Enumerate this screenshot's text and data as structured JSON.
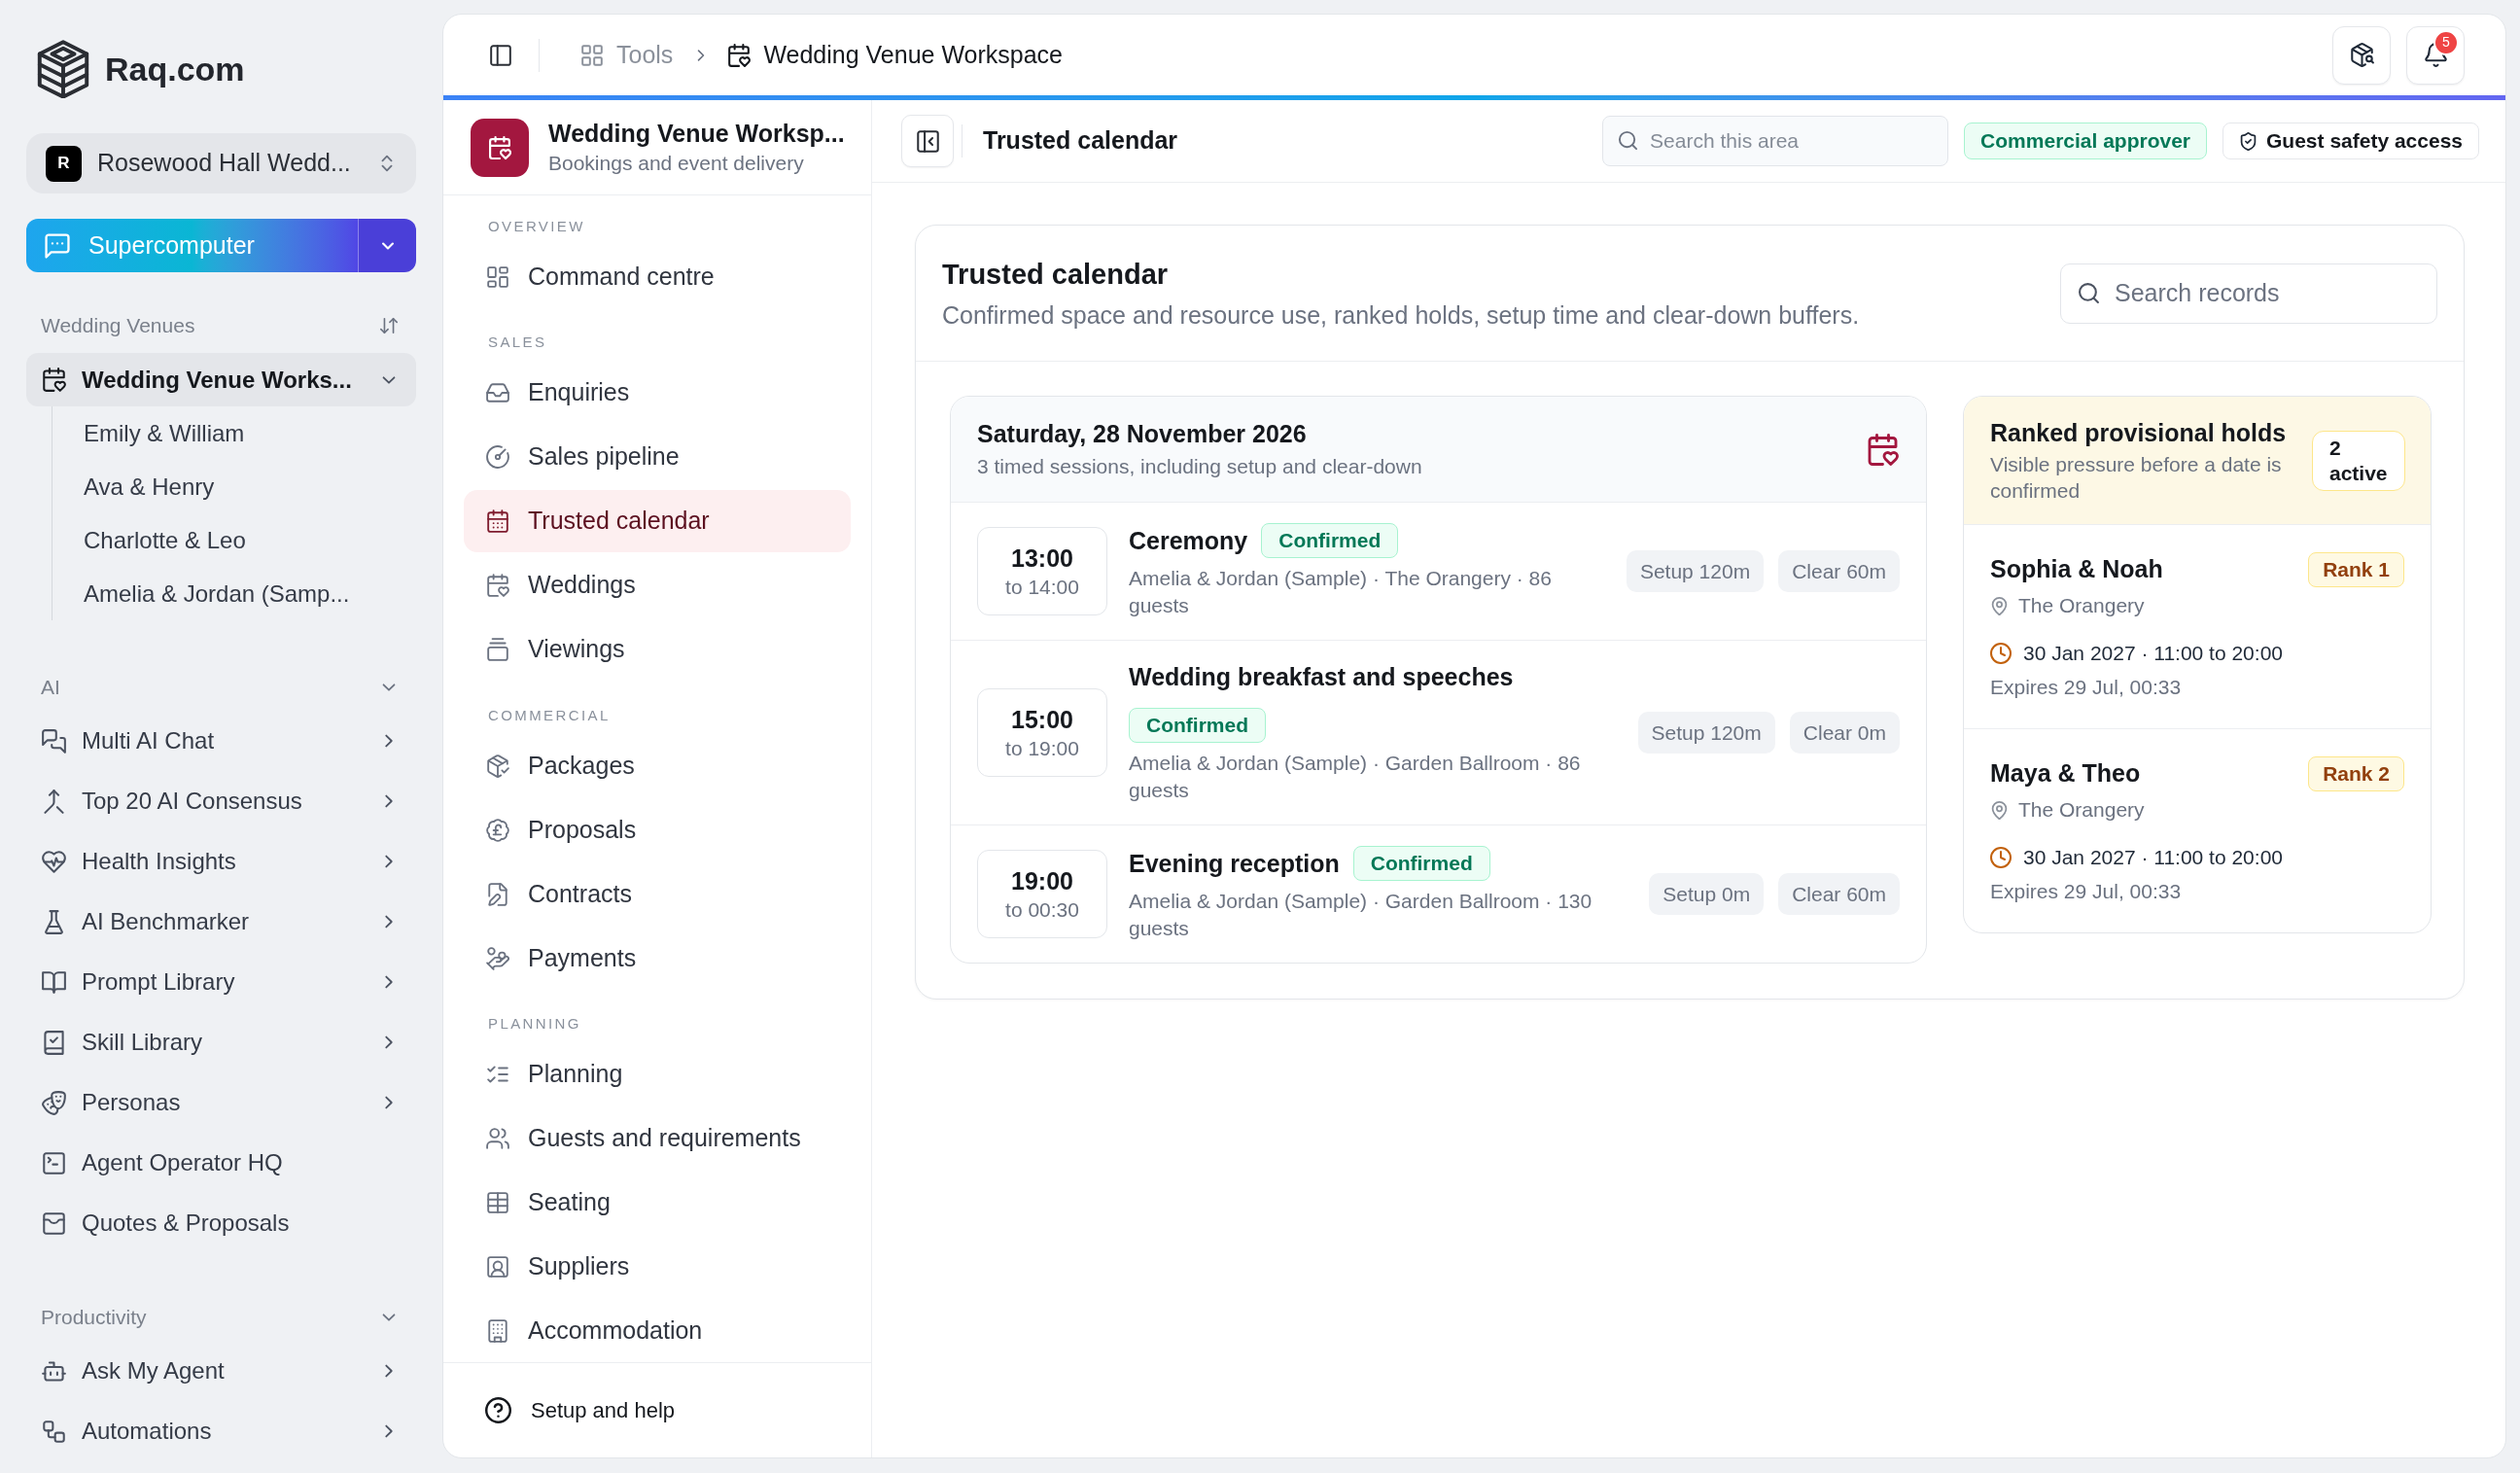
{
  "sidebar": {
    "brand": "Raq.com",
    "workspace": {
      "initial": "R",
      "name": "Rosewood Hall Wedd..."
    },
    "assistant_button": {
      "label": "Supercomputer"
    },
    "sections": [
      {
        "title": "Wedding Venues",
        "kind": "sortable",
        "items": [
          {
            "label": "Wedding Venue Works...",
            "selected": true,
            "expanded": true,
            "children": [
              {
                "label": "Emily & William",
                "selected": false
              },
              {
                "label": "Ava & Henry",
                "selected": false
              },
              {
                "label": "Charlotte & Leo",
                "selected": false
              },
              {
                "label": "Amelia & Jordan (Samp...",
                "selected": false
              }
            ]
          }
        ]
      },
      {
        "title": "AI",
        "kind": "collapsible",
        "expanded": true,
        "items": [
          {
            "label": "Multi AI Chat",
            "selected": false,
            "expandable": true
          },
          {
            "label": "Top 20 AI Consensus",
            "selected": false,
            "expandable": true
          },
          {
            "label": "Health Insights",
            "selected": false,
            "expandable": true
          },
          {
            "label": "AI Benchmarker",
            "selected": false,
            "expandable": true
          },
          {
            "label": "Prompt Library",
            "selected": false,
            "expandable": true
          },
          {
            "label": "Skill Library",
            "selected": false,
            "expandable": true
          },
          {
            "label": "Personas",
            "selected": false,
            "expandable": true
          },
          {
            "label": "Agent Operator HQ",
            "selected": false,
            "expandable": false
          },
          {
            "label": "Quotes & Proposals",
            "selected": false,
            "expandable": false
          }
        ]
      },
      {
        "title": "Productivity",
        "kind": "collapsible",
        "expanded": true,
        "items": [
          {
            "label": "Ask My Agent",
            "selected": false,
            "expandable": true
          },
          {
            "label": "Automations",
            "selected": false,
            "expandable": true
          }
        ]
      }
    ]
  },
  "topbar": {
    "breadcrumbs": [
      {
        "label": "Tools"
      },
      {
        "label": "Wedding Venue Workspace"
      }
    ],
    "notification_count": "5"
  },
  "module_nav": {
    "title": "Wedding Venue Worksp...",
    "subtitle": "Bookings and event delivery",
    "groups": [
      {
        "title": "OVERVIEW",
        "items": [
          {
            "label": "Command centre",
            "selected": false
          }
        ]
      },
      {
        "title": "SALES",
        "items": [
          {
            "label": "Enquiries",
            "selected": false
          },
          {
            "label": "Sales pipeline",
            "selected": false
          },
          {
            "label": "Trusted calendar",
            "selected": true
          },
          {
            "label": "Weddings",
            "selected": false
          },
          {
            "label": "Viewings",
            "selected": false
          }
        ]
      },
      {
        "title": "COMMERCIAL",
        "items": [
          {
            "label": "Packages",
            "selected": false
          },
          {
            "label": "Proposals",
            "selected": false
          },
          {
            "label": "Contracts",
            "selected": false
          },
          {
            "label": "Payments",
            "selected": false
          }
        ]
      },
      {
        "title": "PLANNING",
        "items": [
          {
            "label": "Planning",
            "selected": false
          },
          {
            "label": "Guests and requirements",
            "selected": false
          },
          {
            "label": "Seating",
            "selected": false
          },
          {
            "label": "Suppliers",
            "selected": false
          },
          {
            "label": "Accommodation",
            "selected": false
          }
        ]
      }
    ],
    "footer_link": "Setup and help"
  },
  "page_header": {
    "title": "Trusted calendar",
    "search": {
      "placeholder": "Search this area"
    },
    "badges": [
      {
        "label": "Commercial approver",
        "kind": "role"
      },
      {
        "label": "Guest safety access",
        "kind": "permission"
      }
    ]
  },
  "calendar": {
    "title": "Trusted calendar",
    "description": "Confirmed space and resource use, ranked holds, setup time and clear-down buffers.",
    "search": {
      "placeholder": "Search records"
    },
    "day": {
      "title": "Saturday, 28 November 2026",
      "subtitle": "3 timed sessions, including setup and clear-down",
      "sessions": [
        {
          "start": "13:00",
          "end": "to 14:00",
          "title": "Ceremony",
          "status": "Confirmed",
          "details": "Amelia & Jordan (Sample) · The Orangery · 86 guests",
          "setup": "Setup 120m",
          "clear": "Clear 60m"
        },
        {
          "start": "15:00",
          "end": "to 19:00",
          "title": "Wedding breakfast and speeches",
          "status": "Confirmed",
          "details": "Amelia & Jordan (Sample) · Garden Ballroom · 86 guests",
          "setup": "Setup 120m",
          "clear": "Clear 0m"
        },
        {
          "start": "19:00",
          "end": "to 00:30",
          "title": "Evening reception",
          "status": "Confirmed",
          "details": "Amelia & Jordan (Sample) · Garden Ballroom · 130 guests",
          "setup": "Setup 0m",
          "clear": "Clear 60m"
        }
      ]
    },
    "holds": {
      "title": "Ranked provisional holds",
      "subtitle": "Visible pressure before a date is confirmed",
      "count": "2 active",
      "items": [
        {
          "name": "Sophia & Noah",
          "rank": "Rank 1",
          "location": "The Orangery",
          "when": "30 Jan 2027 · 11:00 to 20:00",
          "expires": "Expires 29 Jul, 00:33"
        },
        {
          "name": "Maya & Theo",
          "rank": "Rank 2",
          "location": "The Orangery",
          "when": "30 Jan 2027 · 11:00 to 20:00",
          "expires": "Expires 29 Jul, 00:33"
        }
      ]
    }
  }
}
